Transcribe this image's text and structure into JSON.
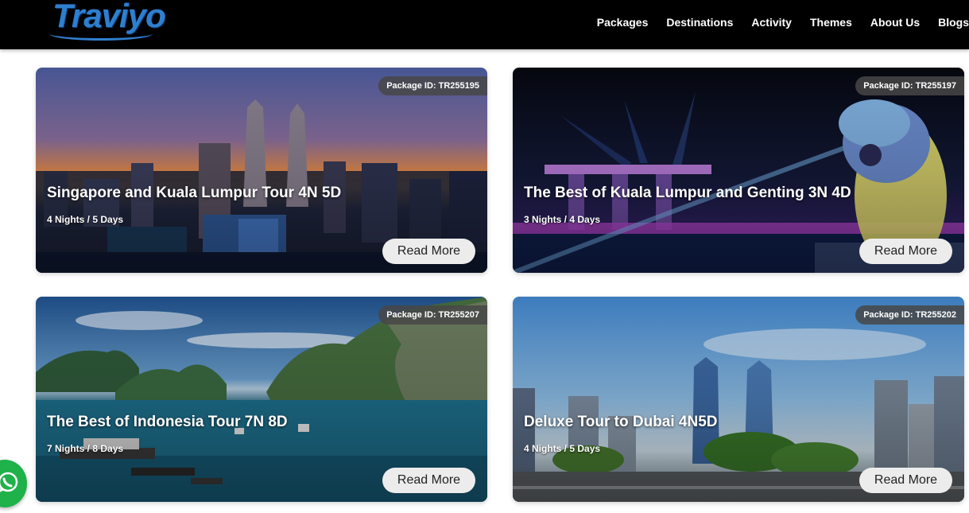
{
  "brand": {
    "name": "Traviyo"
  },
  "nav": {
    "items": [
      {
        "label": "Packages"
      },
      {
        "label": "Destinations"
      },
      {
        "label": "Activity"
      },
      {
        "label": "Themes"
      },
      {
        "label": "About Us"
      },
      {
        "label": "Blogs"
      }
    ]
  },
  "packages": [
    {
      "badge": "Package ID: TR255195",
      "title": "Singapore and Kuala Lumpur Tour 4N 5D",
      "duration": "4 Nights / 5 Days",
      "cta": "Read More"
    },
    {
      "badge": "Package ID: TR255197",
      "title": "The Best of Kuala Lumpur and Genting 3N 4D",
      "duration": "3 Nights / 4 Days",
      "cta": "Read More"
    },
    {
      "badge": "Package ID: TR255207",
      "title": "The Best of Indonesia Tour 7N 8D",
      "duration": "7 Nights / 8 Days",
      "cta": "Read More"
    },
    {
      "badge": "Package ID: TR255202",
      "title": "Deluxe Tour to Dubai 4N5D",
      "duration": "4 Nights / 5 Days",
      "cta": "Read More"
    }
  ],
  "icons": {
    "whatsapp": "whatsapp-icon"
  },
  "colors": {
    "nav_bg": "#000000",
    "brand": "#2f7fcf",
    "whatsapp": "#1fb14a",
    "button_bg": "#ececec"
  }
}
